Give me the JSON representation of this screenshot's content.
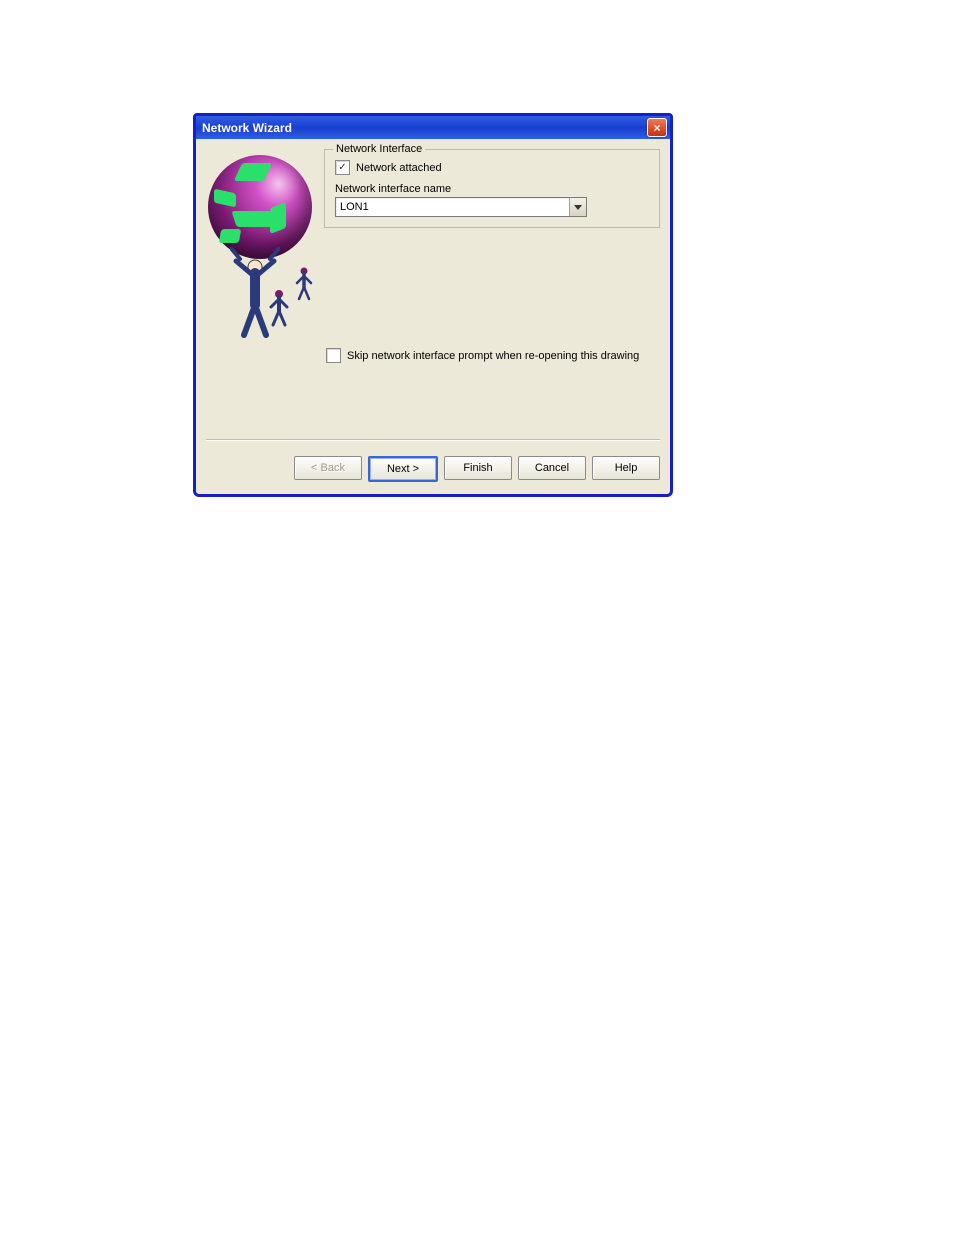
{
  "window": {
    "title": "Network Wizard"
  },
  "group": {
    "legend": "Network Interface",
    "attached_label": "Network attached",
    "attached_checked": true,
    "name_label": "Network interface name",
    "name_value": "LON1"
  },
  "skip": {
    "label": "Skip network interface prompt when re-opening this drawing",
    "checked": false
  },
  "buttons": {
    "back": "< Back",
    "next": "Next >",
    "finish": "Finish",
    "cancel": "Cancel",
    "help": "Help"
  }
}
